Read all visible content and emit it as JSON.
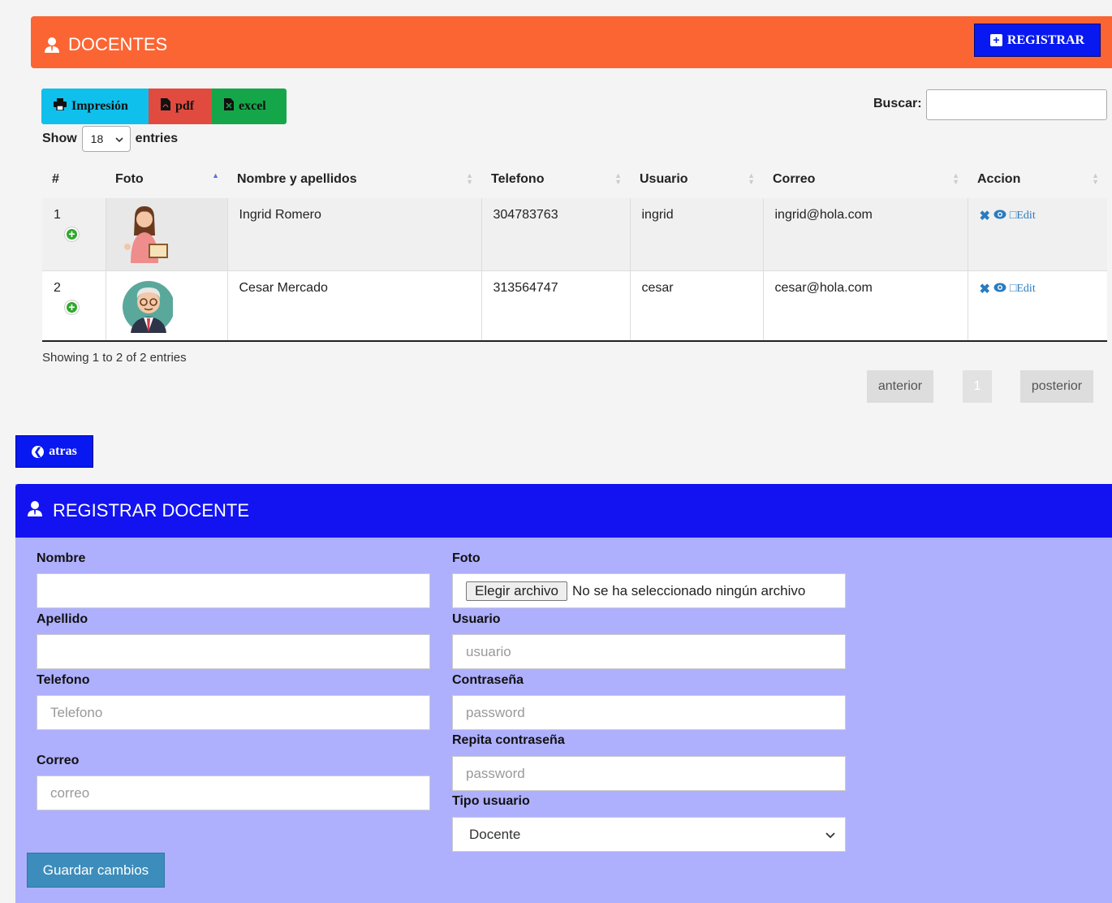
{
  "header": {
    "title": "DOCENTES",
    "register_label": "REGISTRAR"
  },
  "exports": {
    "print_label": "Impresión",
    "pdf_label": "pdf",
    "excel_label": "excel"
  },
  "search": {
    "label": "Buscar:"
  },
  "length": {
    "show_label": "Show",
    "value": "18",
    "entries_label": "entries"
  },
  "table": {
    "headers": [
      "#",
      "Foto",
      "Nombre y apellidos",
      "Telefono",
      "Usuario",
      "Correo",
      "Accion"
    ],
    "rows": [
      {
        "num": "1",
        "name": "Ingrid Romero",
        "phone": "304783763",
        "user": "ingrid",
        "email": "ingrid@hola.com",
        "edit": "Edit"
      },
      {
        "num": "2",
        "name": "Cesar Mercado",
        "phone": "313564747",
        "user": "cesar",
        "email": "cesar@hola.com",
        "edit": "Edit"
      }
    ]
  },
  "info": "Showing 1 to 2 of 2 entries",
  "pagination": {
    "prev": "anterior",
    "page": "1",
    "next": "posterior"
  },
  "back_label": "atras",
  "form": {
    "title": "REGISTRAR DOCENTE",
    "nombre_label": "Nombre",
    "apellido_label": "Apellido",
    "telefono_label": "Telefono",
    "telefono_placeholder": "Telefono",
    "correo_label": "Correo",
    "correo_placeholder": "correo",
    "foto_label": "Foto",
    "file_button": "Elegir archivo",
    "file_status": "No se ha seleccionado ningún archivo",
    "usuario_label": "Usuario",
    "usuario_placeholder": "usuario",
    "password_label": "Contraseña",
    "password_placeholder": "password",
    "repeat_label": "Repita contraseña",
    "repeat_placeholder": "password",
    "tipo_label": "Tipo usuario",
    "tipo_value": "Docente",
    "save_label": "Guardar cambios"
  },
  "colors": {
    "orange_header": "#fb6533",
    "blue_button": "#0718f0",
    "form_bg": "#aeb0fd",
    "form_header": "#1213f0",
    "save_button": "#3c8dbc"
  }
}
